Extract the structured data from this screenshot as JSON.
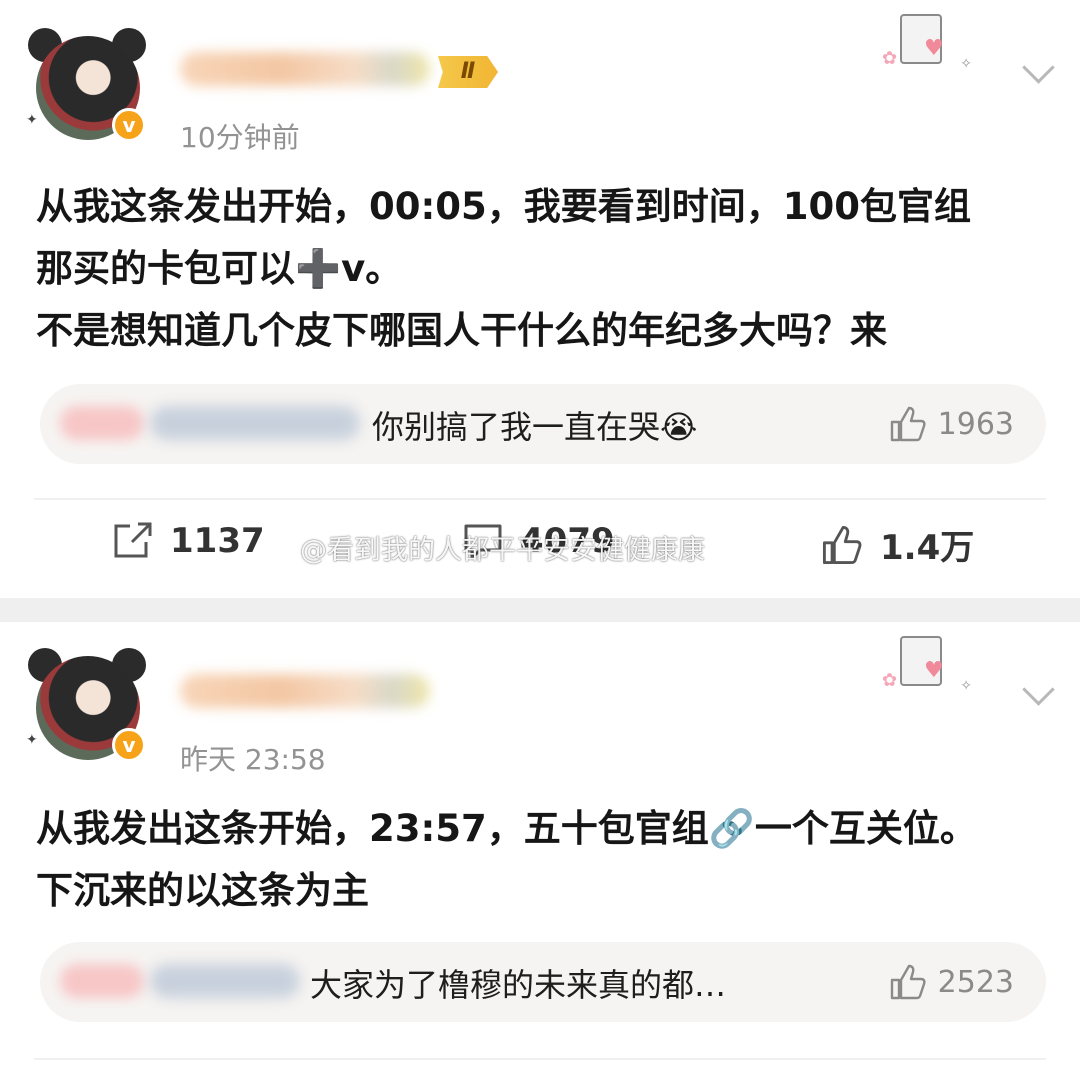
{
  "posts": [
    {
      "time": "10分钟前",
      "level_badge": "Ⅱ",
      "content": "从我这条发出开始，00:05，我要看到时间，100包官组\n那买的卡包可以➕v。\n不是想知道几个皮下哪国人干什么的年纪多大吗？来",
      "hot_comment": {
        "text": "你别搞了我一直在哭😭",
        "likes": "1963"
      },
      "actions": {
        "repost": "1137",
        "comment": "4079",
        "like": "1.4万"
      }
    },
    {
      "time": "昨天 23:58",
      "content": "从我发出这条开始，23:57，五十包官组🔗一个互关位。\n下沉来的以这条为主",
      "hot_comment": {
        "text": "大家为了橹穆的未来真的都…",
        "likes": "2523"
      }
    }
  ],
  "watermark": "@看到我的人都平平安安健健康康",
  "icons": {
    "verified": "v-badge-icon",
    "chevron": "chevron-down-icon",
    "like": "thumbs-up-icon",
    "repost": "repost-icon",
    "comment": "comment-icon"
  },
  "colors": {
    "accent": "#f6a31a",
    "text": "#161616",
    "muted": "#939393"
  }
}
